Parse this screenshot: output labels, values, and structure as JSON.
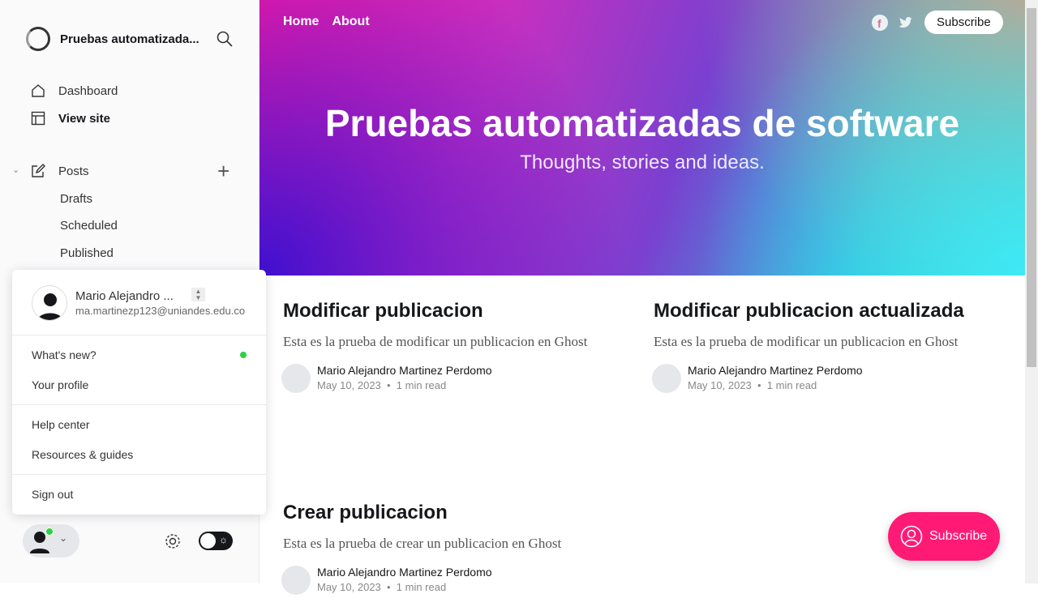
{
  "sidebar": {
    "site_title": "Pruebas automatizada...",
    "nav": [
      "Dashboard",
      "View site"
    ],
    "posts": "Posts",
    "sub": [
      "Drafts",
      "Scheduled",
      "Published"
    ]
  },
  "menu": {
    "name": "Mario Alejandro ...",
    "email": "ma.martinezp123@uniandes.edu.co",
    "items": [
      "What's new?",
      "Your profile",
      "Help center",
      "Resources & guides",
      "Sign out"
    ]
  },
  "site": {
    "nav": [
      "Home",
      "About"
    ],
    "subscribe": "Subscribe",
    "title": "Pruebas automatizadas de software",
    "description": "Thoughts, stories and ideas.",
    "portal_label": "Subscribe"
  },
  "posts": [
    {
      "title": "Modificar publicacion",
      "excerpt": "Esta es la prueba de modificar un publicacion en Ghost",
      "author": "Mario Alejandro Martinez Perdomo",
      "date": "May 10, 2023",
      "read": "1 min read"
    },
    {
      "title": "Modificar publicacion actualizada",
      "excerpt": "Esta es la prueba de modificar un publicacion en Ghost",
      "author": "Mario Alejandro Martinez Perdomo",
      "date": "May 10, 2023",
      "read": "1 min read"
    },
    {
      "title": "Crear publicacion",
      "excerpt": "Esta es la prueba de crear un publicacion en Ghost",
      "author": "Mario Alejandro Martinez Perdomo",
      "date": "May 10, 2023",
      "read": "1 min read"
    }
  ],
  "colors": {
    "accent": "#ff1a75",
    "status_dot": "#30cf43"
  }
}
